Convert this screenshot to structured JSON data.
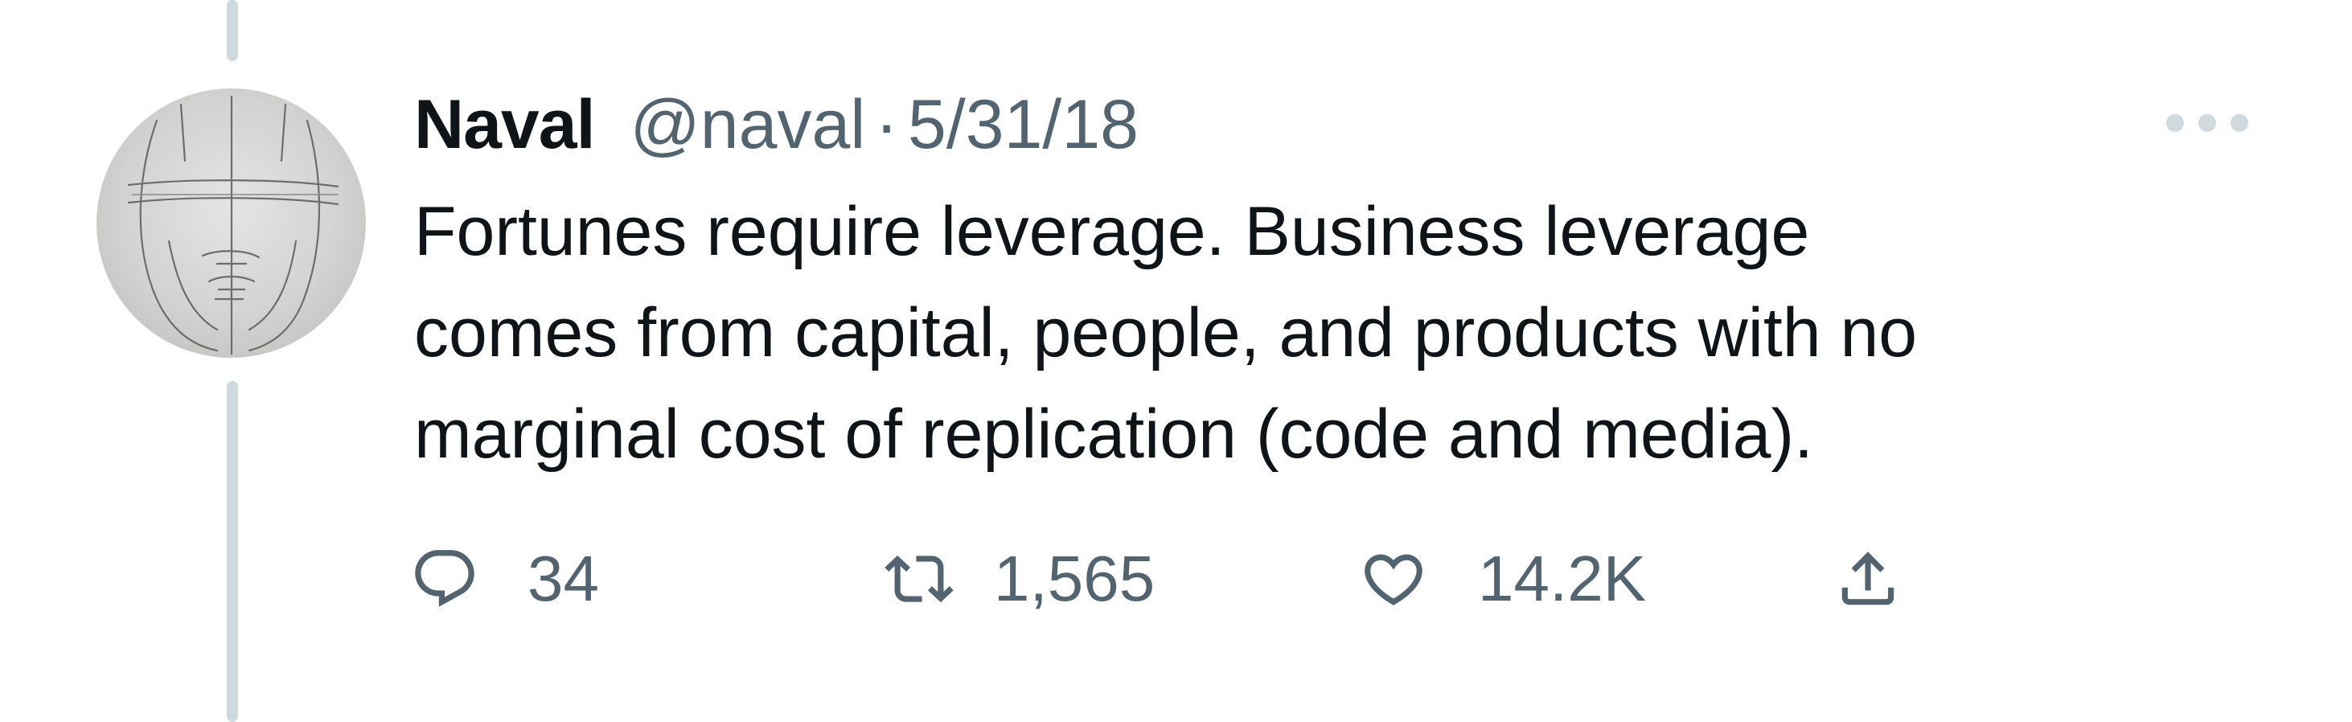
{
  "tweet": {
    "author": {
      "display_name": "Naval",
      "handle": "@naval"
    },
    "separator": "·",
    "date": "5/31/18",
    "text_lines": [
      "Fortunes require leverage. Business leverage",
      "comes from capital, people, and products with no",
      "marginal cost of replication (code and media)."
    ],
    "actions": {
      "reply": {
        "icon": "reply-bubble-icon",
        "count": "34"
      },
      "retweet": {
        "icon": "retweet-icon",
        "count": "1,565"
      },
      "like": {
        "icon": "heart-icon",
        "count": "14.2K"
      },
      "share": {
        "icon": "share-upload-icon"
      }
    },
    "more_icon": "more-dots-icon"
  },
  "colors": {
    "primary_text": "#0f1419",
    "secondary_text": "#536471",
    "thread_line": "#cfd9de",
    "more_dots": "#cfd9de"
  }
}
